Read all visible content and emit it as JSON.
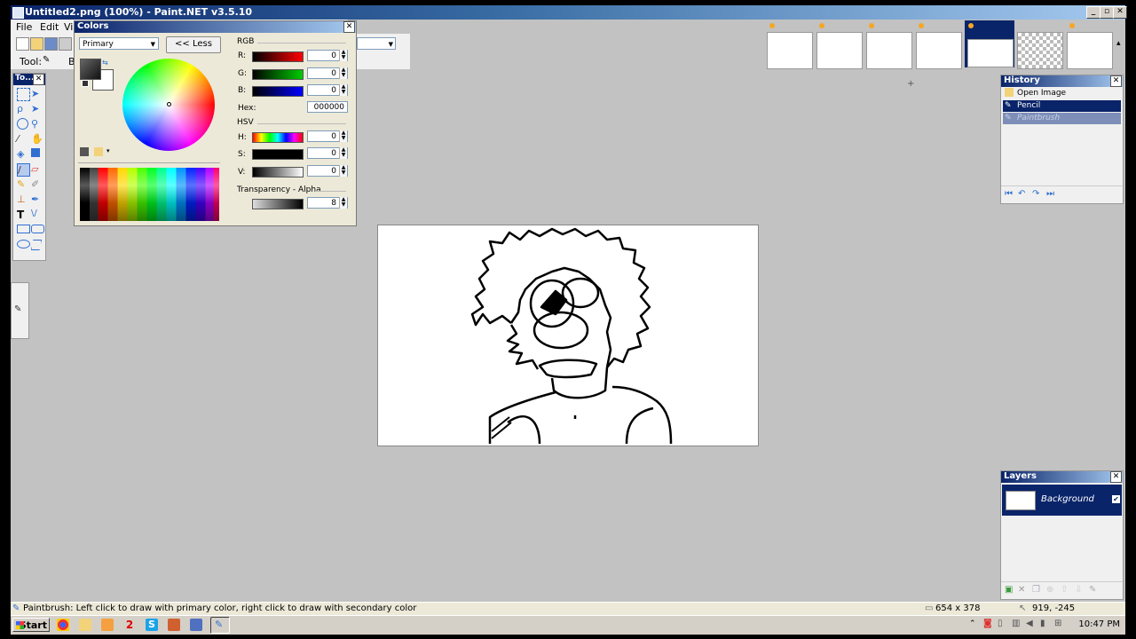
{
  "window": {
    "title": "Untitled2.png (100%) - Paint.NET v3.5.10"
  },
  "menu": {
    "file": "File",
    "edit": "Edit",
    "view": "Vi"
  },
  "toolbar": {
    "tool_label": "Tool:",
    "brush_label": "B"
  },
  "tools_panel": {
    "title": "To..."
  },
  "colors": {
    "title": "Colors",
    "mode": "Primary",
    "less_button": "<< Less",
    "rgb_label": "RGB",
    "r_label": "R:",
    "r_value": "0",
    "g_label": "G:",
    "g_value": "0",
    "b_label": "B:",
    "b_value": "0",
    "hex_label": "Hex:",
    "hex_value": "000000",
    "hsv_label": "HSV",
    "h_label": "H:",
    "h_value": "0",
    "s_label": "S:",
    "s_value": "0",
    "v_label": "V:",
    "v_value": "0",
    "alpha_label": "Transparency - Alpha",
    "alpha_value": "8"
  },
  "history": {
    "title": "History",
    "items": [
      {
        "label": "Open Image"
      },
      {
        "label": "Pencil"
      },
      {
        "label": "Paintbrush"
      }
    ]
  },
  "layers": {
    "title": "Layers",
    "items": [
      {
        "label": "Background"
      }
    ]
  },
  "status": {
    "hint": "Paintbrush: Left click to draw with primary color, right click to draw with secondary color",
    "image_size": "654 x 378",
    "cursor_pos": "919, -245"
  },
  "taskbar": {
    "start": "Start",
    "clock": "10:47 PM"
  },
  "colors_accent": {
    "title_blue": "#0a246a",
    "history_selected": "#0a246a"
  }
}
